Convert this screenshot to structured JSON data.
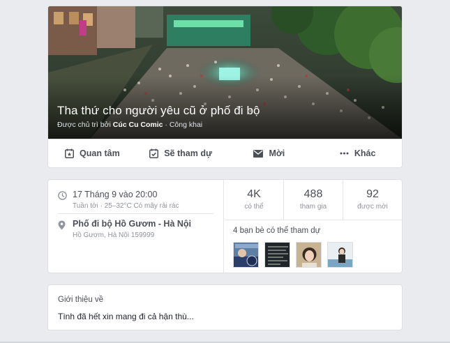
{
  "event": {
    "title": "Tha thứ cho người yêu cũ ở phố đi bộ",
    "host_prefix": "Được chủ trì bởi ",
    "host_name": "Cúc Cu Comic",
    "privacy": " · Công khai"
  },
  "actions": [
    {
      "label": "Quan tâm",
      "icon": "star-calendar-icon"
    },
    {
      "label": "Sẽ tham dự",
      "icon": "check-calendar-icon"
    },
    {
      "label": "Mời",
      "icon": "envelope-icon"
    },
    {
      "label": "Khác",
      "icon": "more-dots-icon"
    }
  ],
  "details": {
    "time_main": "17 Tháng 9 vào 20:00",
    "time_sub": "Tuần tới · 25–32°C Có mây rải rác",
    "place_main": "Phố đi bộ Hồ Gươm - Hà Nội",
    "place_sub": "Hồ Gươm, Hà Nội 159999"
  },
  "stats": [
    {
      "num": "4K",
      "label": "có thể"
    },
    {
      "num": "488",
      "label": "tham gia"
    },
    {
      "num": "92",
      "label": "được mời"
    }
  ],
  "friends_label": "4 bạn bè có thể tham dự",
  "about": {
    "title": "Giới thiệu về",
    "text": "Tình đã hết xin mang đi cả hận thù..."
  },
  "colors": {
    "page_bg": "#e9ebee",
    "text_secondary": "#90949c",
    "action_text": "#4b4f56"
  }
}
